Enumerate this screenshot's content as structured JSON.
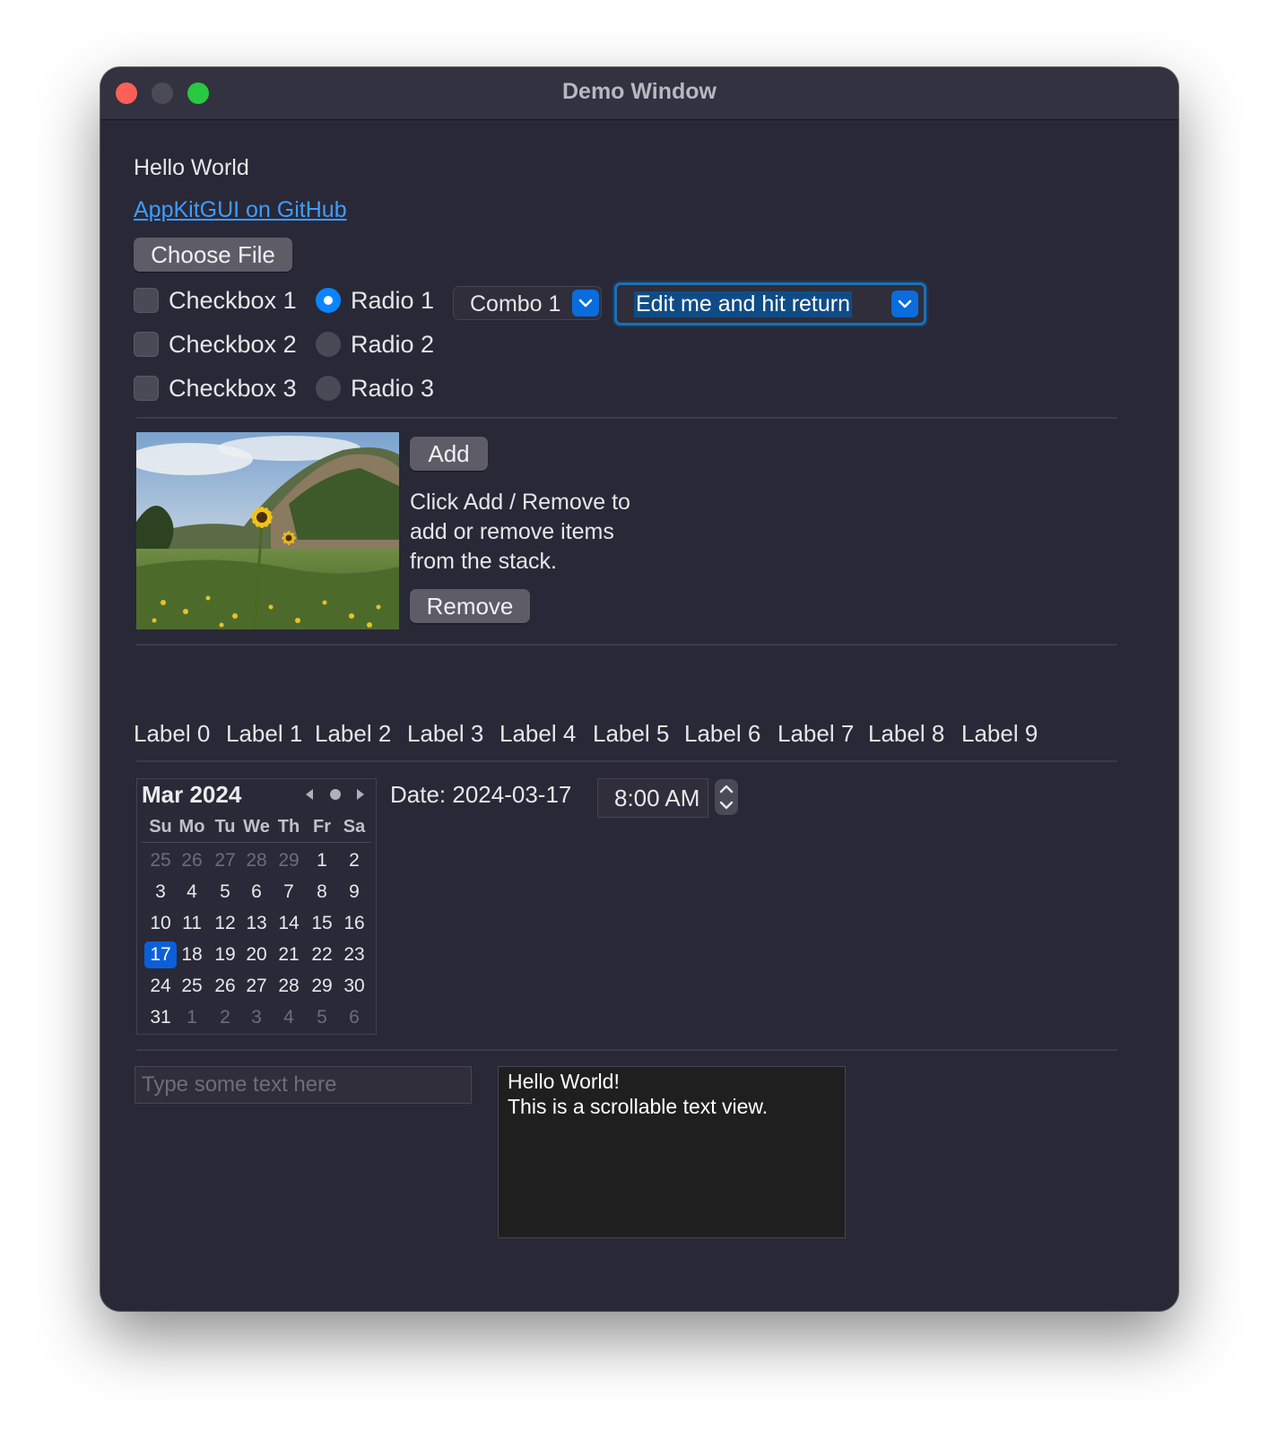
{
  "window": {
    "title": "Demo Window"
  },
  "hello": "Hello World",
  "link": "AppKitGUI on GitHub",
  "choose_file": "Choose File",
  "checkboxes": [
    {
      "label": "Checkbox 1",
      "checked": false
    },
    {
      "label": "Checkbox 2",
      "checked": false
    },
    {
      "label": "Checkbox 3",
      "checked": false
    }
  ],
  "radios": [
    {
      "label": "Radio 1",
      "selected": true
    },
    {
      "label": "Radio 2",
      "selected": false
    },
    {
      "label": "Radio 3",
      "selected": false
    }
  ],
  "combo": {
    "value": "Combo 1"
  },
  "editable_combo": {
    "value": "Edit me and hit return"
  },
  "stack": {
    "add": "Add",
    "description": [
      "Click Add / Remove to",
      "add or remove items",
      "from the stack."
    ],
    "remove": "Remove"
  },
  "labels": [
    "Label 0",
    "Label 1",
    "Label 2",
    "Label 3",
    "Label 4",
    "Label 5",
    "Label 6",
    "Label 7",
    "Label 8",
    "Label 9"
  ],
  "calendar": {
    "month": "Mar 2024",
    "weekdays": [
      "Su",
      "Mo",
      "Tu",
      "We",
      "Th",
      "Fr",
      "Sa"
    ],
    "weeks": [
      [
        "25",
        "26",
        "27",
        "28",
        "29",
        "1",
        "2"
      ],
      [
        "3",
        "4",
        "5",
        "6",
        "7",
        "8",
        "9"
      ],
      [
        "10",
        "11",
        "12",
        "13",
        "14",
        "15",
        "16"
      ],
      [
        "17",
        "18",
        "19",
        "20",
        "21",
        "22",
        "23"
      ],
      [
        "24",
        "25",
        "26",
        "27",
        "28",
        "29",
        "30"
      ],
      [
        "31",
        "1",
        "2",
        "3",
        "4",
        "5",
        "6"
      ]
    ],
    "selected_day": "17"
  },
  "date_label": "Date: 2024-03-17",
  "time": "8:00 AM",
  "text_field": {
    "placeholder": "Type some text here",
    "value": ""
  },
  "text_view": [
    "Hello World!",
    "This is a scrollable text view."
  ],
  "colors": {
    "accent": "#0a84ff",
    "link": "#3f9cff",
    "window_bg": "#292836"
  }
}
